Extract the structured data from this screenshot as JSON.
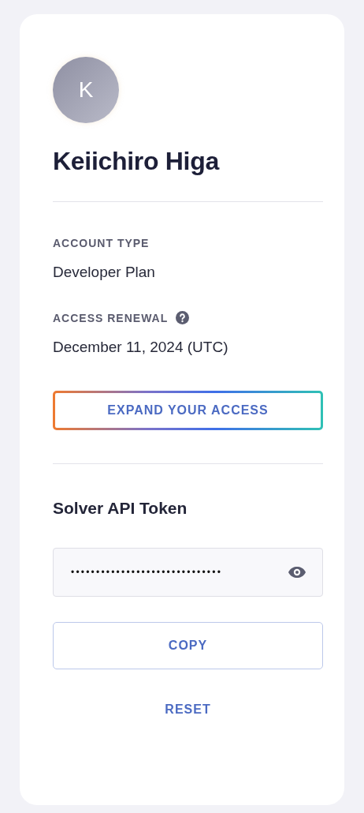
{
  "profile": {
    "avatar_initial": "K",
    "name": "Keiichiro Higa"
  },
  "fields": [
    {
      "label": "ACCOUNT TYPE",
      "value": "Developer Plan",
      "help": false
    },
    {
      "label": "ACCESS RENEWAL",
      "value": "December 11, 2024 (UTC)",
      "help": true
    }
  ],
  "expand_button": "EXPAND YOUR ACCESS",
  "token": {
    "title": "Solver API Token",
    "value": "••••••••••••••••••••••••••••••",
    "revealed": false
  },
  "buttons": [
    {
      "label": "COPY",
      "kind": "outlined"
    },
    {
      "label": "RESET",
      "kind": "text"
    }
  ]
}
